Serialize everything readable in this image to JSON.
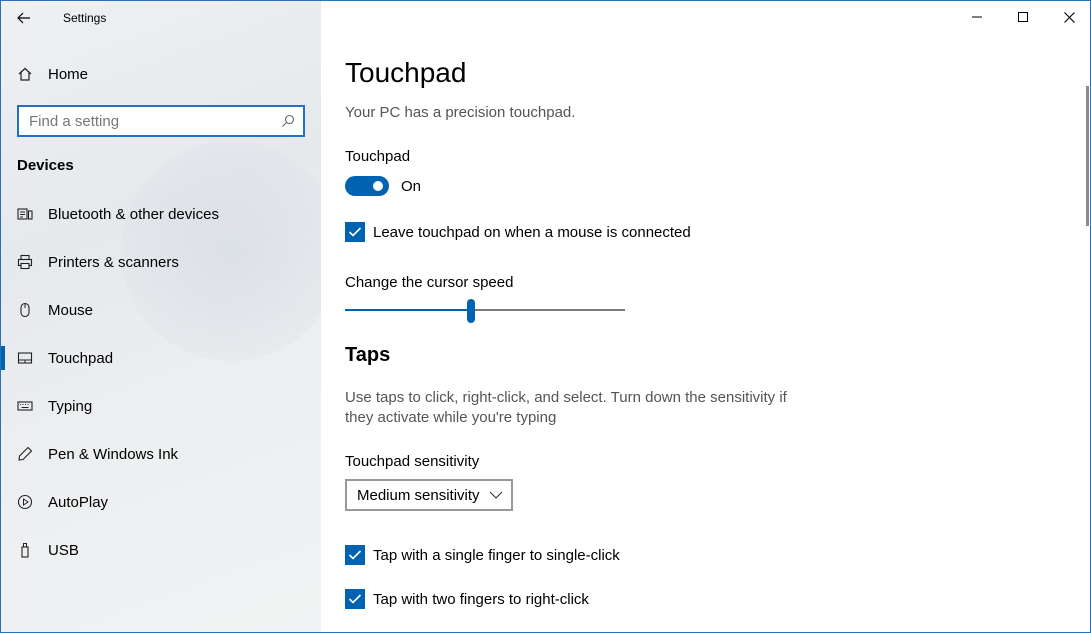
{
  "window": {
    "title": "Settings"
  },
  "sidebar": {
    "home_label": "Home",
    "search": {
      "placeholder": "Find a setting"
    },
    "section_title": "Devices",
    "items": [
      {
        "label": "Bluetooth & other devices",
        "icon": "bluetooth-devices-icon"
      },
      {
        "label": "Printers & scanners",
        "icon": "printer-icon"
      },
      {
        "label": "Mouse",
        "icon": "mouse-icon"
      },
      {
        "label": "Touchpad",
        "icon": "touchpad-icon",
        "active": true
      },
      {
        "label": "Typing",
        "icon": "keyboard-icon"
      },
      {
        "label": "Pen & Windows Ink",
        "icon": "pen-icon"
      },
      {
        "label": "AutoPlay",
        "icon": "autoplay-icon"
      },
      {
        "label": "USB",
        "icon": "usb-icon"
      }
    ]
  },
  "main": {
    "title": "Touchpad",
    "subtitle": "Your PC has a precision touchpad.",
    "touchpad_label": "Touchpad",
    "touchpad_toggle": {
      "state_label": "On",
      "on": true
    },
    "leave_on_checkbox": {
      "label": "Leave touchpad on when a mouse is connected",
      "checked": true
    },
    "cursor_speed": {
      "label": "Change the cursor speed",
      "value_fraction": 0.45
    },
    "taps": {
      "title": "Taps",
      "description": "Use taps to click, right-click, and select. Turn down the sensitivity if they activate while you're typing",
      "sensitivity_label": "Touchpad sensitivity",
      "sensitivity_value": "Medium sensitivity",
      "single_finger": {
        "label": "Tap with a single finger to single-click",
        "checked": true
      },
      "two_finger": {
        "label": "Tap with two fingers to right-click",
        "checked": true
      }
    }
  },
  "colors": {
    "accent": "#0063b1",
    "search_border": "#1b74c9"
  }
}
